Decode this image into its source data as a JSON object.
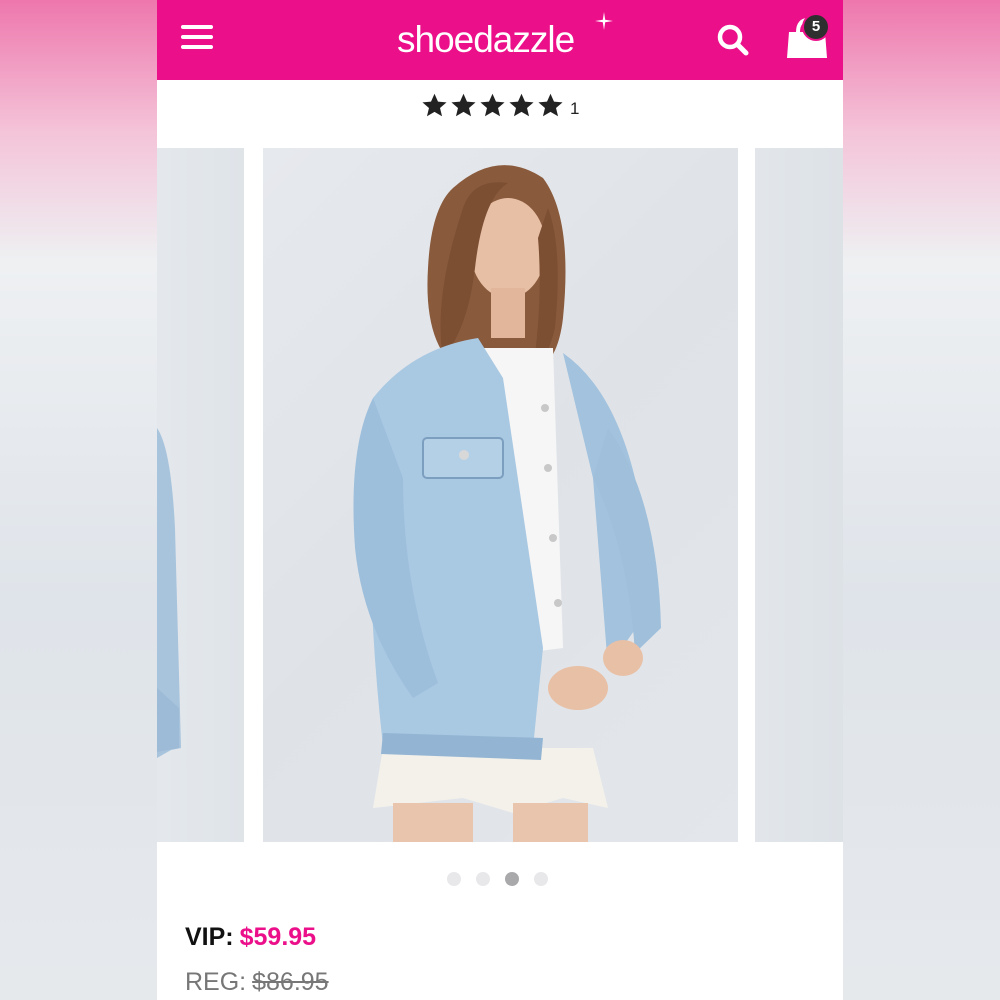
{
  "header": {
    "logo_text": "shoedazzle",
    "cart_count": "5",
    "background_color": "#eb0f8a"
  },
  "icons": {
    "menu": "hamburger-menu-icon",
    "search": "search-icon",
    "cart": "shopping-bag-icon"
  },
  "rating": {
    "stars": 5,
    "count": "1"
  },
  "gallery": {
    "slide_count": 4,
    "active_index": 2
  },
  "pricing": {
    "vip_label": "VIP:",
    "vip_price": "$59.95",
    "reg_label": "REG:",
    "reg_price": "$86.95",
    "accent_color": "#eb0f8a"
  }
}
